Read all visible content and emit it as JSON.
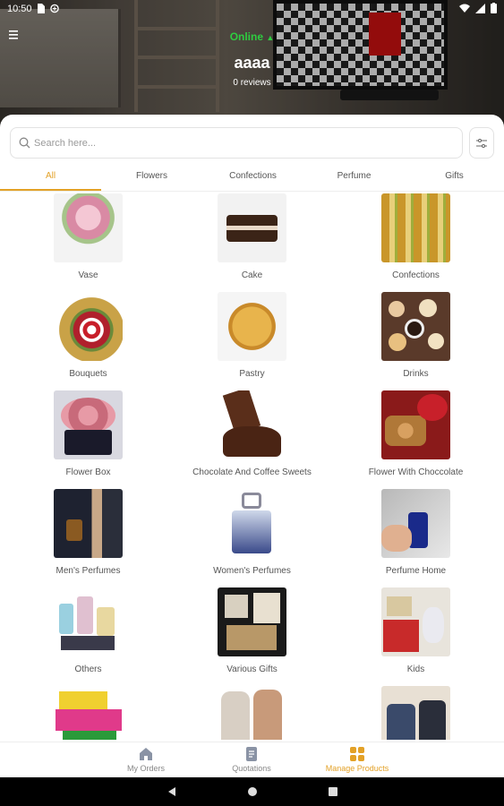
{
  "status_bar": {
    "time": "10:50"
  },
  "header": {
    "status": "Online",
    "shop_name": "aaaa",
    "reviews": "0 reviews"
  },
  "search": {
    "placeholder": "Search here..."
  },
  "tabs": [
    {
      "label": "All",
      "active": true
    },
    {
      "label": "Flowers"
    },
    {
      "label": "Confections"
    },
    {
      "label": "Perfume"
    },
    {
      "label": "Gifts"
    }
  ],
  "categories": [
    {
      "label": "Vase",
      "icon": "vase-photo"
    },
    {
      "label": "Cake",
      "icon": "cake-photo"
    },
    {
      "label": "Confections",
      "icon": "confections-photo"
    },
    {
      "label": "Bouquets",
      "icon": "bouquet-photo"
    },
    {
      "label": "Pastry",
      "icon": "pastry-photo"
    },
    {
      "label": "Drinks",
      "icon": "drinks-photo"
    },
    {
      "label": "Flower Box",
      "icon": "flower-box-photo"
    },
    {
      "label": "Chocolate And Coffee Sweets",
      "icon": "chocolate-photo"
    },
    {
      "label": "Flower With Chocco­late",
      "icon": "flower-chocolate-photo"
    },
    {
      "label": "Men's Perfumes",
      "icon": "mens-perfume-photo"
    },
    {
      "label": "Women's Perfumes",
      "icon": "womens-perfume-photo"
    },
    {
      "label": "Perfume Home",
      "icon": "perfume-home-photo"
    },
    {
      "label": "Others",
      "icon": "others-photo"
    },
    {
      "label": "Various Gifts",
      "icon": "various-gifts-photo"
    },
    {
      "label": "Kids",
      "icon": "kids-photo"
    },
    {
      "label": "",
      "icon": "gift-boxes-photo"
    },
    {
      "label": "",
      "icon": "clothing-photo"
    },
    {
      "label": "",
      "icon": "jacket-photo"
    }
  ],
  "bottom_nav": [
    {
      "label": "My Orders",
      "icon": "home-icon"
    },
    {
      "label": "Quotations",
      "icon": "document-icon"
    },
    {
      "label": "Manage Products",
      "icon": "grid-icon",
      "active": true
    }
  ],
  "colors": {
    "accent": "#e3a127",
    "online": "#2ecc40"
  }
}
